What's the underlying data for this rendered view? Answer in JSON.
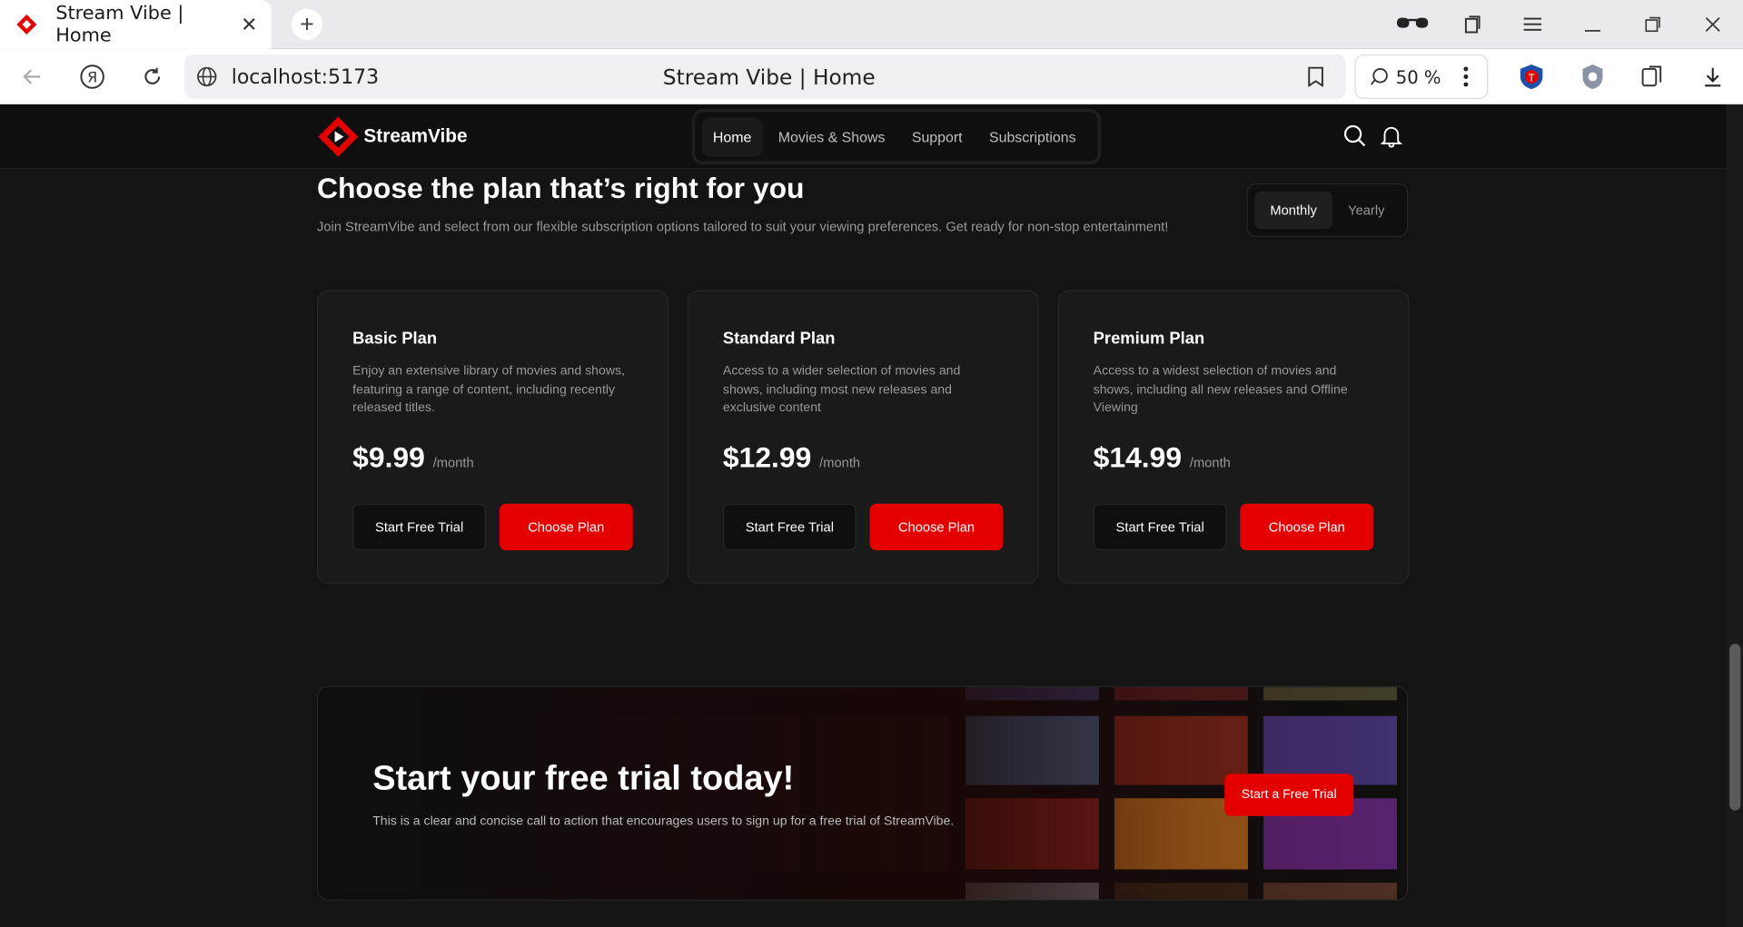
{
  "browser": {
    "tab_title": "Stream Vibe | Home",
    "url": "localhost:5173",
    "page_title": "Stream Vibe | Home",
    "zoom": "50 %"
  },
  "header": {
    "logo_text": "StreamVibe",
    "nav": [
      {
        "label": "Home",
        "active": true
      },
      {
        "label": "Movies & Shows",
        "active": false
      },
      {
        "label": "Support",
        "active": false
      },
      {
        "label": "Subscriptions",
        "active": false
      }
    ]
  },
  "pricing": {
    "title": "Choose the plan that’s right for you",
    "subtitle": "Join StreamVibe and select from our flexible subscription options tailored to suit your viewing preferences. Get ready for non-stop entertainment!",
    "toggle": {
      "monthly": "Monthly",
      "yearly": "Yearly",
      "selected": "Monthly"
    },
    "plans": [
      {
        "name": "Basic Plan",
        "description": "Enjoy an extensive library of movies and shows, featuring a range of content, including recently released titles.",
        "price": "$9.99",
        "period": "/month",
        "trial_label": "Start Free Trial",
        "choose_label": "Choose Plan"
      },
      {
        "name": "Standard Plan",
        "description": "Access to a wider selection of movies and shows, including most new releases and exclusive content",
        "price": "$12.99",
        "period": "/month",
        "trial_label": "Start Free Trial",
        "choose_label": "Choose Plan"
      },
      {
        "name": "Premium Plan",
        "description": "Access to a widest selection of movies and shows, including all new releases and Offline Viewing",
        "price": "$14.99",
        "period": "/month",
        "trial_label": "Start Free Trial",
        "choose_label": "Choose Plan"
      }
    ]
  },
  "cta": {
    "title": "Start your free trial today!",
    "subtitle": "This is a clear and concise call to action that encourages users to sign up for a free trial of StreamVibe.",
    "button_label": "Start a Free Trial"
  },
  "colors": {
    "accent": "#e50000",
    "background": "#141414",
    "card": "#1a1a1a"
  }
}
